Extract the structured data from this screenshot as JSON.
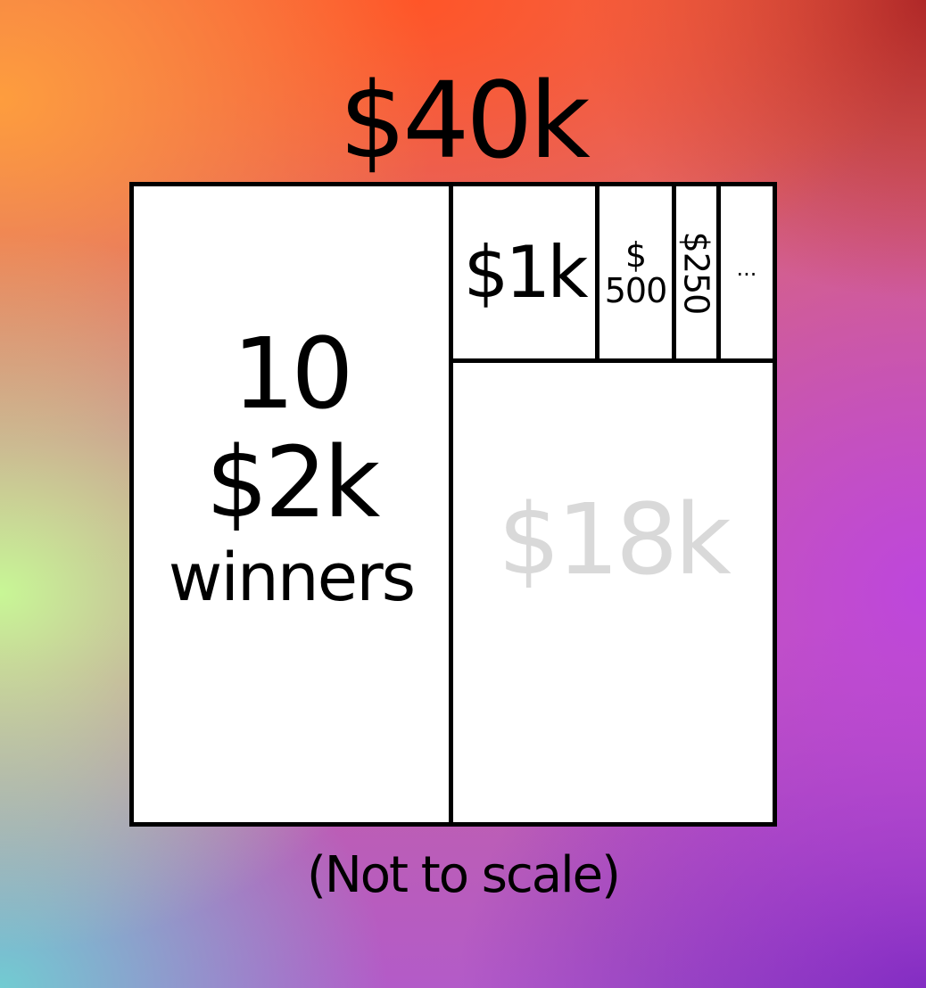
{
  "total_pool": "$40k",
  "blocks": {
    "winners": {
      "count": "10",
      "amount": "$2k",
      "label": "winners"
    },
    "prize_1k": "$1k",
    "prize_500_symbol": "$",
    "prize_500_amount": "500",
    "prize_250": "$250",
    "more": "...",
    "remaining": "$18k"
  },
  "footnote": "(Not to scale)",
  "colors": {
    "remaining_text": "#d9d9d9",
    "border": "#000000",
    "block_fill": "#ffffff"
  }
}
